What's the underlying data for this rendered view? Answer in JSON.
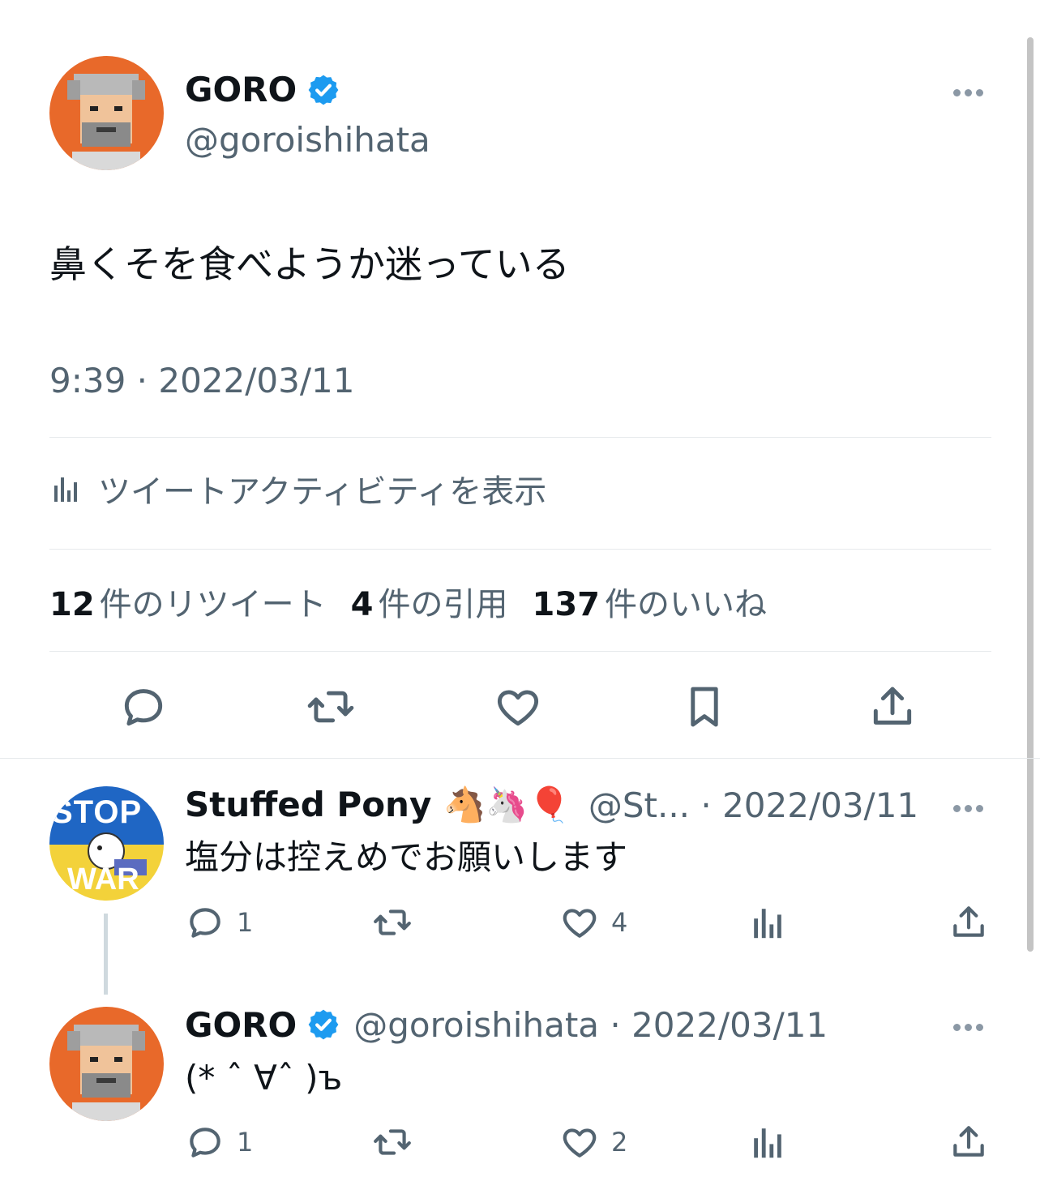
{
  "main_tweet": {
    "name": "GORO",
    "handle": "@goroishihata",
    "text": "鼻くそを食べようか迷っている",
    "time": "9:39 · 2022/03/11",
    "activity_label": "ツイートアクティビティを表示",
    "stats": {
      "retweets_count": "12",
      "retweets_label": "件のリツイート",
      "quotes_count": "4",
      "quotes_label": "件の引用",
      "likes_count": "137",
      "likes_label": "件のいいね"
    }
  },
  "replies": [
    {
      "name": "Stuffed Pony 🐴🦄🎈",
      "handle_date": "@St... · 2022/03/11",
      "text": "塩分は控えめでお願いします",
      "reply_count": "1",
      "retweet_count": "",
      "like_count": "4",
      "avatar_text_top": "STOP",
      "avatar_text_bottom": "WAR"
    },
    {
      "name": "GORO",
      "handle_date": "@goroishihata · 2022/03/11",
      "text": "(* ˆ ∀ˆ )ъ",
      "reply_count": "1",
      "retweet_count": "",
      "like_count": "2"
    }
  ],
  "colors": {
    "verified": "#1d9bf0",
    "avatar_orange": "#e8692a",
    "ukraine_blue": "#1f66c4",
    "ukraine_yellow": "#f3d23a"
  },
  "icons": [
    "verified-badge-icon",
    "more-icon",
    "analytics-icon",
    "reply-icon",
    "retweet-icon",
    "like-icon",
    "bookmark-icon",
    "share-icon"
  ]
}
